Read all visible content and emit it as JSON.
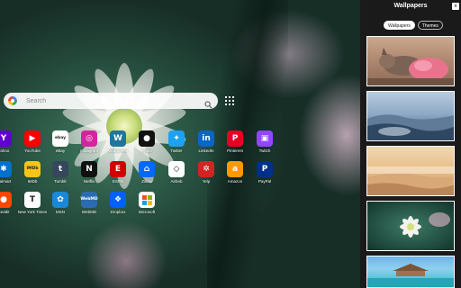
{
  "search": {
    "placeholder": "Search"
  },
  "shortcuts": [
    {
      "label": "Yahoo",
      "color": "#6001d2",
      "glyph": "Y",
      "icon": "yahoo-icon"
    },
    {
      "label": "YouTube",
      "color": "#ff0000",
      "glyph": "▶",
      "icon": "youtube-icon"
    },
    {
      "label": "eBay",
      "color": "#ffffff",
      "glyph": "ebay",
      "icon": "ebay-icon"
    },
    {
      "label": "Instagram",
      "color": "#d6249f",
      "glyph": "◎",
      "icon": "instagram-icon"
    },
    {
      "label": "Wordpress",
      "color": "#21759b",
      "glyph": "W",
      "icon": "wordpress-icon"
    },
    {
      "label": "Apple",
      "color": "#111111",
      "glyph": "●",
      "icon": "apple-icon"
    },
    {
      "label": "Twitter",
      "color": "#1da1f2",
      "glyph": "✦",
      "icon": "twitter-icon"
    },
    {
      "label": "LinkedIn",
      "color": "#0a66c2",
      "glyph": "in",
      "icon": "linkedin-icon"
    },
    {
      "label": "Pinterest",
      "color": "#e60023",
      "glyph": "P",
      "icon": "pinterest-icon"
    },
    {
      "label": "Twitch",
      "color": "#9146ff",
      "glyph": "▣",
      "icon": "twitch-icon"
    },
    {
      "label": "Walmart",
      "color": "#0071ce",
      "glyph": "✱",
      "icon": "walmart-icon"
    },
    {
      "label": "IMDb",
      "color": "#f5c518",
      "glyph": "IMDb",
      "icon": "imdb-icon"
    },
    {
      "label": "Tumblr",
      "color": "#36465d",
      "glyph": "t",
      "icon": "tumblr-icon"
    },
    {
      "label": "Netflix",
      "color": "#111111",
      "glyph": "N",
      "icon": "netflix-icon"
    },
    {
      "label": "ESPN",
      "color": "#d00000",
      "glyph": "E",
      "icon": "espn-icon"
    },
    {
      "label": "Zillow",
      "color": "#006aff",
      "glyph": "⌂",
      "icon": "zillow-icon"
    },
    {
      "label": "Airbnb",
      "color": "#ffffff",
      "glyph": "◇",
      "icon": "airbnb-icon"
    },
    {
      "label": "Yelp",
      "color": "#d32323",
      "glyph": "✲",
      "icon": "yelp-icon"
    },
    {
      "label": "Amazon",
      "color": "#ff9900",
      "glyph": "a",
      "icon": "amazon-icon"
    },
    {
      "label": "PayPal",
      "color": "#003087",
      "glyph": "P",
      "icon": "paypal-icon"
    },
    {
      "label": "Reddit",
      "color": "#ff4500",
      "glyph": "●",
      "icon": "reddit-icon"
    },
    {
      "label": "New York Times",
      "color": "#ffffff",
      "glyph": "T",
      "icon": "nyt-icon"
    },
    {
      "label": "MSN",
      "color": "#1a88d6",
      "glyph": "✿",
      "icon": "msn-icon"
    },
    {
      "label": "WebMD",
      "color": "#2b6cb0",
      "glyph": "WebMD",
      "icon": "webmd-icon"
    },
    {
      "label": "Dropbox",
      "color": "#0061ff",
      "glyph": "❖",
      "icon": "dropbox-icon"
    },
    {
      "label": "Microsoft",
      "color": "#ffffff",
      "glyph": "",
      "icon": "microsoft-icon"
    }
  ],
  "panel": {
    "title": "Wallpapers",
    "close": "x",
    "tabs": [
      {
        "label": "Wallpapers",
        "active": true
      },
      {
        "label": "Themes",
        "active": false
      }
    ],
    "thumbnails": [
      {
        "name": "cat-wallpaper-thumb"
      },
      {
        "name": "rocky-coast-wallpaper-thumb"
      },
      {
        "name": "foggy-desert-wallpaper-thumb"
      },
      {
        "name": "dahlia-wallpaper-thumb"
      },
      {
        "name": "tropical-resort-wallpaper-thumb"
      }
    ]
  }
}
